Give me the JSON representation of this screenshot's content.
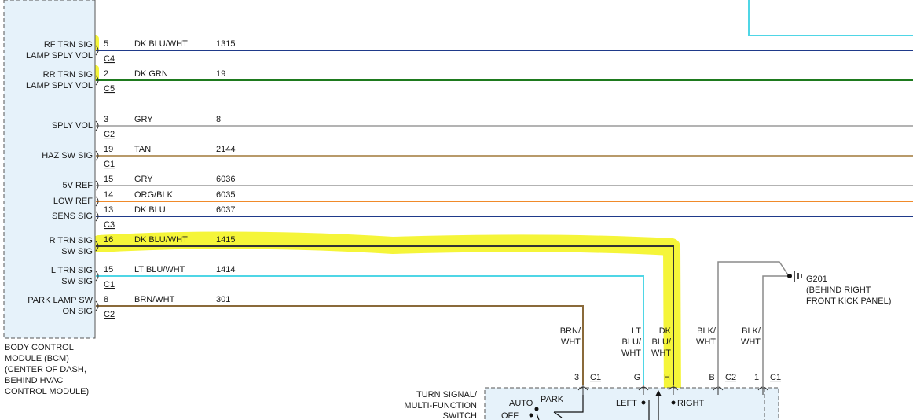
{
  "bcm": {
    "name_lines": [
      "BODY CONTROL",
      "MODULE (BCM)",
      "(CENTER OF DASH,",
      "BEHIND HVAC",
      "CONTROL MODULE)"
    ],
    "fill": "#e6f2fa"
  },
  "circuits": [
    {
      "label_lines": [
        "RF TRN SIG",
        "LAMP SPLY VOL"
      ],
      "pin": "5",
      "wire": "DK BLU/WHT",
      "circuit": "1315",
      "connector": "C4",
      "color": "#1f3a8a"
    },
    {
      "label_lines": [
        "RR TRN SIG",
        "LAMP SPLY VOL"
      ],
      "pin": "2",
      "wire": "DK GRN",
      "circuit": "19",
      "connector": "C5",
      "color": "#1e7a1e"
    },
    {
      "label_lines": [
        "SPLY VOL"
      ],
      "pin": "3",
      "wire": "GRY",
      "circuit": "8",
      "connector": "C2",
      "color": "#b3b3b3"
    },
    {
      "label_lines": [
        "HAZ SW SIG"
      ],
      "pin": "19",
      "wire": "TAN",
      "circuit": "2144",
      "connector": "C1",
      "color": "#b89a6a"
    },
    {
      "label_lines": [
        "5V REF"
      ],
      "pin": "15",
      "wire": "GRY",
      "circuit": "6036",
      "connector": "",
      "color": "#b3b3b3"
    },
    {
      "label_lines": [
        "LOW REF"
      ],
      "pin": "14",
      "wire": "ORG/BLK",
      "circuit": "6035",
      "connector": "",
      "color": "#f08a2a"
    },
    {
      "label_lines": [
        "SENS SIG"
      ],
      "pin": "13",
      "wire": "DK BLU",
      "circuit": "6037",
      "connector": "C3",
      "color": "#1f3a8a"
    },
    {
      "label_lines": [
        "R TRN SIG",
        "SW SIG"
      ],
      "pin": "16",
      "wire": "DK BLU/WHT",
      "circuit": "1415",
      "connector": "",
      "color": "#333333"
    },
    {
      "label_lines": [
        "L TRN SIG",
        "SW SIG"
      ],
      "pin": "15",
      "wire": "LT BLU/WHT",
      "circuit": "1414",
      "connector": "C1",
      "color": "#4fd6e6"
    },
    {
      "label_lines": [
        "PARK LAMP SW",
        "ON SIG"
      ],
      "pin": "8",
      "wire": "BRN/WHT",
      "circuit": "301",
      "connector": "C2",
      "color": "#8a6a3a"
    }
  ],
  "switch": {
    "title_lines": [
      "TURN SIGNAL/",
      "MULTI-FUNCTION",
      "SWITCH"
    ],
    "fill": "#e6f2fa",
    "positions": [
      "AUTO",
      "PARK",
      "OFF",
      "LEFT",
      "RIGHT"
    ],
    "connectors": [
      {
        "pin": "3",
        "connector": "C1",
        "wire_lines": [
          "BRN/",
          "WHT"
        ]
      },
      {
        "pin": "G",
        "connector": "",
        "wire_lines": [
          "LT",
          "BLU/",
          "WHT"
        ]
      },
      {
        "pin": "H",
        "connector": "",
        "wire_lines": [
          "DK",
          "BLU/",
          "WHT"
        ]
      },
      {
        "pin": "B",
        "connector": "C2",
        "wire_lines": [
          "BLK/",
          "WHT"
        ]
      },
      {
        "pin": "1",
        "connector": "C1",
        "wire_lines": [
          "BLK/",
          "WHT"
        ]
      }
    ]
  },
  "ground": {
    "id": "G201",
    "location_lines": [
      "(BEHIND RIGHT",
      "FRONT KICK PANEL)"
    ]
  },
  "colors": {
    "highlight": "#f4f423",
    "ground_wire": "#8a8a8a",
    "top_wire": "#4fd6e6"
  }
}
